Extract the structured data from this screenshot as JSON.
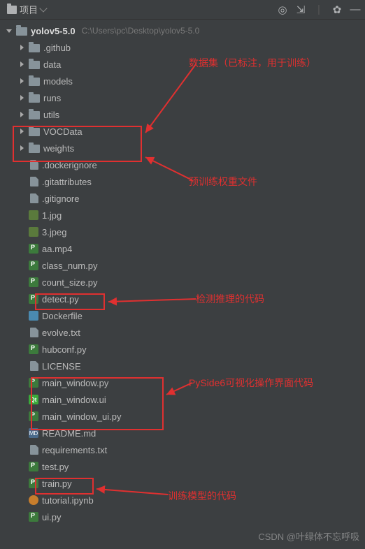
{
  "toolbar": {
    "project_label": "项目"
  },
  "root": {
    "name": "yolov5-5.0",
    "path": "C:\\Users\\pc\\Desktop\\yolov5-5.0"
  },
  "items": [
    {
      "name": ".github",
      "type": "folder",
      "arrow": "right"
    },
    {
      "name": "data",
      "type": "folder",
      "arrow": "right"
    },
    {
      "name": "models",
      "type": "folder",
      "arrow": "right"
    },
    {
      "name": "runs",
      "type": "folder",
      "arrow": "right"
    },
    {
      "name": "utils",
      "type": "folder",
      "arrow": "right"
    },
    {
      "name": "VOCData",
      "type": "folder",
      "arrow": "right"
    },
    {
      "name": "weights",
      "type": "folder",
      "arrow": "right"
    },
    {
      "name": ".dockerignore",
      "type": "file"
    },
    {
      "name": ".gitattributes",
      "type": "file"
    },
    {
      "name": ".gitignore",
      "type": "file"
    },
    {
      "name": "1.jpg",
      "type": "img"
    },
    {
      "name": "3.jpeg",
      "type": "img"
    },
    {
      "name": "aa.mp4",
      "type": "py"
    },
    {
      "name": "class_num.py",
      "type": "py"
    },
    {
      "name": "count_size.py",
      "type": "py"
    },
    {
      "name": "detect.py",
      "type": "py"
    },
    {
      "name": "Dockerfile",
      "type": "docker"
    },
    {
      "name": "evolve.txt",
      "type": "file"
    },
    {
      "name": "hubconf.py",
      "type": "py"
    },
    {
      "name": "LICENSE",
      "type": "file"
    },
    {
      "name": "main_window.py",
      "type": "py"
    },
    {
      "name": "main_window.ui",
      "type": "ui"
    },
    {
      "name": "main_window_ui.py",
      "type": "py"
    },
    {
      "name": "README.md",
      "type": "md"
    },
    {
      "name": "requirements.txt",
      "type": "file"
    },
    {
      "name": "test.py",
      "type": "py"
    },
    {
      "name": "train.py",
      "type": "py"
    },
    {
      "name": "tutorial.ipynb",
      "type": "nb"
    },
    {
      "name": "ui.py",
      "type": "py"
    }
  ],
  "annotations": {
    "a1": "数据集（已标注，用于训练）",
    "a2": "预训练权重文件",
    "a3": "检测推理的代码",
    "a4": "PySide6可视化操作界面代码",
    "a5": "训练模型的代码"
  },
  "watermark": "CSDN @叶绿体不忘呼吸"
}
